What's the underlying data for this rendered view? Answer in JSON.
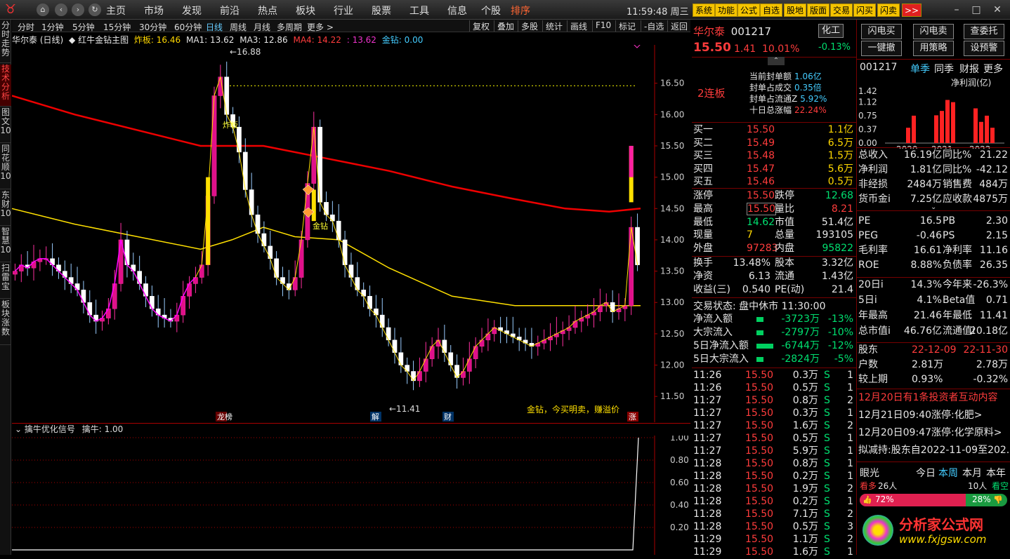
{
  "topbar": {
    "menus": [
      "主页",
      "市场",
      "发现",
      "前沿",
      "热点",
      "板块",
      "行业",
      "股票",
      "工具",
      "信息",
      "个股",
      "排序"
    ],
    "clock": "11:59:48 周三",
    "tools": [
      "系统",
      "功能",
      "公式",
      "自选",
      "股地",
      "版面",
      "交易",
      "闪买",
      "闪卖"
    ],
    "more": ">>"
  },
  "left_tabs": [
    "分时走势",
    "技术分析",
    "图文10",
    "同花顺10",
    "东财10",
    "智慧10",
    "扫雷宝",
    "板块涨数"
  ],
  "period_tabs": [
    "分时",
    "1分钟",
    "5分钟",
    "15分钟",
    "30分钟",
    "60分钟",
    "日线",
    "周线",
    "月线",
    "多周期",
    "更多 >"
  ],
  "chart_tools": [
    "复权",
    "叠加",
    "多股",
    "统计",
    "画线",
    "F10",
    "标记",
    "-自选",
    "返回"
  ],
  "chart_header": {
    "stock": "华尔泰 (日线)",
    "indicator": "红牛金钻主图",
    "zha": "炸板: 16.46",
    "ma1": "MA1: 13.62",
    "ma3": "MA3: 12.86",
    "ma4": "MA4: 14.22",
    "ma_extra": ": 13.62",
    "jz": "金钻: 0.00"
  },
  "chart_data": {
    "type": "candlestick",
    "x": [
      "d1",
      "d2",
      "d3",
      "d4",
      "d5",
      "d6",
      "d7",
      "d8",
      "d9",
      "d10",
      "d11",
      "d12",
      "d13",
      "d14",
      "d15",
      "d16",
      "d17",
      "d18",
      "d19",
      "d20",
      "d21",
      "d22",
      "d23",
      "d24",
      "d25",
      "d26",
      "d27",
      "d28",
      "d29",
      "d30",
      "d31",
      "d32",
      "d33",
      "d34",
      "d35",
      "d36",
      "d37",
      "d38",
      "d39",
      "d40",
      "d41",
      "d42",
      "d43",
      "d44",
      "d45",
      "d46",
      "d47",
      "d48",
      "d49",
      "d50",
      "d51",
      "d52",
      "d53",
      "d54",
      "d55",
      "d56",
      "d57",
      "d58",
      "d59",
      "d60",
      "d61",
      "d62",
      "d63",
      "d64",
      "d65",
      "d66",
      "d67",
      "d68",
      "d69",
      "d70",
      "d71",
      "d72",
      "d73",
      "d74",
      "d75",
      "d76",
      "d77",
      "d78",
      "d79",
      "d80",
      "d81",
      "d82",
      "d83",
      "d84",
      "d85",
      "d86",
      "d87",
      "d88",
      "d89",
      "d90",
      "d91",
      "d92",
      "d93",
      "d94",
      "d95",
      "d96",
      "d97",
      "d98",
      "d99",
      "d100",
      "d101",
      "d102",
      "d103",
      "d104",
      "d105",
      "d106",
      "d107",
      "d108",
      "d109",
      "d110",
      "d111",
      "d112",
      "d113",
      "d114",
      "d115",
      "d116",
      "d117",
      "d118",
      "d119",
      "d120",
      "d121",
      "d122",
      "d123",
      "d124",
      "d125",
      "d126",
      "d127",
      "d128",
      "d129",
      "d130",
      "d131",
      "d132",
      "d133",
      "d134",
      "d135",
      "d136",
      "d137",
      "d138",
      "d139",
      "d140",
      "d141",
      "d142",
      "d143",
      "d144",
      "d145",
      "d146",
      "d147",
      "d148",
      "d149",
      "d150",
      "d151",
      "d152",
      "d153",
      "d154",
      "d155",
      "d156",
      "d157",
      "d158",
      "d159",
      "d160",
      "d161",
      "d162",
      "d163",
      "d164",
      "d165",
      "d166",
      "d167",
      "d168",
      "d169",
      "d170",
      "d171",
      "d172",
      "d173",
      "d174",
      "d175",
      "d176",
      "d177",
      "d178",
      "d179",
      "d180",
      "d181",
      "d182",
      "d183",
      "d184",
      "d185",
      "d186",
      "d187",
      "d188",
      "d189",
      "d190",
      "d191",
      "d192",
      "d193",
      "d194",
      "d195",
      "d196",
      "d197",
      "d198",
      "d199",
      "d200",
      "d201",
      "d202",
      "d203",
      "d204",
      "d205",
      "d206",
      "d207",
      "d208",
      "d209",
      "d210",
      "d211",
      "d212",
      "d213",
      "d214",
      "d215",
      "d216",
      "d217",
      "d218",
      "d219",
      "d220",
      "d221",
      "d222",
      "d223",
      "d224",
      "d225",
      "d226",
      "d227",
      "d228",
      "d229",
      "d230",
      "d231",
      "d232",
      "d233",
      "d234",
      "d235",
      "d236",
      "d237",
      "d238",
      "d239",
      "d240",
      "d241",
      "d242",
      "d243",
      "d244",
      "d245",
      "d246",
      "d247",
      "d248",
      "d249",
      "d250",
      "d251",
      "d252",
      "d253",
      "d254",
      "d255",
      "d256",
      "d257",
      "d258",
      "d259",
      "d260",
      "d261",
      "d262",
      "d263",
      "d264",
      "d265",
      "d266",
      "d267",
      "d268",
      "d269",
      "d270",
      "d271",
      "d272",
      "d273",
      "d274",
      "d275",
      "d276",
      "d277",
      "d278",
      "d279",
      "d280",
      "d281",
      "d282",
      "d283",
      "d284",
      "d285",
      "d286",
      "d287",
      "d288",
      "d289",
      "d290",
      "d291",
      "d292",
      "d293",
      "d294",
      "d295",
      "d296",
      "d297",
      "d298",
      "d299",
      "d300"
    ],
    "ylim": [
      11.2,
      17.0
    ],
    "yticks": [
      16.5,
      16.0,
      15.5,
      15.0,
      14.5,
      14.0,
      13.5,
      13.0,
      12.5,
      12.0,
      11.5
    ],
    "ma_red": [
      [
        0,
        16.3
      ],
      [
        0.1,
        16.0
      ],
      [
        0.3,
        15.5
      ],
      [
        0.4,
        15.5
      ],
      [
        0.5,
        15.3
      ],
      [
        0.6,
        15.1
      ],
      [
        0.7,
        14.85
      ],
      [
        0.8,
        14.65
      ],
      [
        0.88,
        14.5
      ],
      [
        0.95,
        14.45
      ],
      [
        1.0,
        14.5
      ]
    ],
    "ma_yellow": [
      [
        0,
        14.5
      ],
      [
        0.1,
        14.25
      ],
      [
        0.2,
        14.05
      ],
      [
        0.3,
        13.85
      ],
      [
        0.35,
        14.0
      ],
      [
        0.4,
        14.2
      ],
      [
        0.45,
        14.05
      ],
      [
        0.52,
        14.0
      ],
      [
        0.6,
        13.55
      ],
      [
        0.7,
        13.1
      ],
      [
        0.8,
        12.95
      ],
      [
        0.88,
        12.95
      ],
      [
        0.95,
        12.95
      ],
      [
        1.0,
        12.95
      ]
    ],
    "closes": [
      13.5,
      13.6,
      13.55,
      13.65,
      13.7,
      13.7,
      13.6,
      13.5,
      13.4,
      13.3,
      13.2,
      13.0,
      12.8,
      12.7,
      12.75,
      12.9,
      13.3,
      14.0,
      13.6,
      13.5,
      13.3,
      13.1,
      12.9,
      12.8,
      12.75,
      12.7,
      12.8,
      13.1,
      13.3,
      13.4,
      13.6,
      14.7,
      16.3,
      16.6,
      16.0,
      15.8,
      15.4,
      14.8,
      14.4,
      14.1,
      13.9,
      13.7,
      13.4,
      13.3,
      13.2,
      13.4,
      14.0,
      14.9,
      15.8,
      14.6,
      14.4,
      14.3,
      14.0,
      13.6,
      13.4,
      13.2,
      13.1,
      12.9,
      12.8,
      12.6,
      12.4,
      12.2,
      12.0,
      11.9,
      11.75,
      11.9,
      12.1,
      12.3,
      12.4,
      12.2,
      12.0,
      11.8,
      11.9,
      12.1,
      12.3,
      12.4,
      12.5,
      12.6,
      12.55,
      12.5,
      12.45,
      12.4,
      12.35,
      12.3,
      12.35,
      12.4,
      12.45,
      12.5,
      12.55,
      12.6,
      12.7,
      12.75,
      12.8,
      12.85,
      12.95,
      13.0,
      12.85,
      12.9,
      12.95,
      14.2,
      13.6
    ],
    "annotations": [
      "16.88",
      "11.41",
      "炸板",
      "金钻",
      "金钻，今买明卖，赚溢价",
      "龙榜",
      "解",
      "财",
      "涨"
    ]
  },
  "indicator": {
    "name": "擒牛优化信号",
    "value": "擒牛: 1.00",
    "yticks": [
      "1.00",
      "0.80",
      "0.60",
      "0.40",
      "0.20"
    ]
  },
  "quote": {
    "name": "华尔泰",
    "code": "001217",
    "sector": "化工",
    "sector_change": "-0.13%",
    "price": "15.50",
    "change": "1.41",
    "pct": "10.01%",
    "board": "2连板",
    "seal": [
      {
        "label": "当前封单额",
        "value": "1.06亿"
      },
      {
        "label": "封单占成交",
        "value": "0.35倍"
      },
      {
        "label": "封单占流通Z",
        "value": "5.92%"
      },
      {
        "label": "十日总涨幅",
        "value": "22.24%"
      }
    ],
    "bids": [
      {
        "label": "买一",
        "price": "15.50",
        "vol": "1.1亿"
      },
      {
        "label": "买二",
        "price": "15.49",
        "vol": "6.5万"
      },
      {
        "label": "买三",
        "price": "15.48",
        "vol": "1.5万"
      },
      {
        "label": "买四",
        "price": "15.47",
        "vol": "5.6万"
      },
      {
        "label": "买五",
        "price": "15.46",
        "vol": "0.5万"
      }
    ],
    "stats": [
      {
        "l1": "涨停",
        "v1": "15.50",
        "l2": "跌停",
        "v2": "12.68"
      },
      {
        "l1": "最高",
        "v1": "15.50",
        "l2": "量比",
        "v2": "8.21"
      },
      {
        "l1": "最低",
        "v1": "14.62",
        "l2": "市值",
        "v2": "51.4亿"
      },
      {
        "l1": "现量",
        "v1": "7",
        "l2": "总量",
        "v2": "193105"
      },
      {
        "l1": "外盘",
        "v1": "97283",
        "l2": "内盘",
        "v2": "95822"
      }
    ],
    "stats2": [
      {
        "l1": "换手",
        "v1": "13.48%",
        "l2": "股本",
        "v2": "3.32亿"
      },
      {
        "l1": "净资",
        "v1": "6.13",
        "l2": "流通",
        "v2": "1.43亿"
      },
      {
        "l1": "收益(三)",
        "v1": "0.540",
        "l2": "PE(动)",
        "v2": "21.4"
      }
    ],
    "trade_state": "交易状态: 盘中休市 11:30:00",
    "flows": [
      {
        "label": "净流入额",
        "value": "-3723万",
        "pct": "-13%"
      },
      {
        "label": "大宗流入",
        "value": "-2797万",
        "pct": "-10%"
      },
      {
        "label": "5日净流入额",
        "value": "-6744万",
        "pct": "-12%"
      },
      {
        "label": "5日大宗流入",
        "value": "-2824万",
        "pct": "-5%"
      }
    ],
    "ticks": [
      {
        "t": "11:26",
        "p": "15.50",
        "v": "0.3万",
        "s": "S",
        "n": "1"
      },
      {
        "t": "11:26",
        "p": "15.50",
        "v": "0.5万",
        "s": "S",
        "n": "1"
      },
      {
        "t": "11:27",
        "p": "15.50",
        "v": "0.8万",
        "s": "S",
        "n": "2"
      },
      {
        "t": "11:27",
        "p": "15.50",
        "v": "0.3万",
        "s": "S",
        "n": "1"
      },
      {
        "t": "11:27",
        "p": "15.50",
        "v": "1.6万",
        "s": "S",
        "n": "2"
      },
      {
        "t": "11:27",
        "p": "15.50",
        "v": "0.5万",
        "s": "S",
        "n": "1"
      },
      {
        "t": "11:27",
        "p": "15.50",
        "v": "5.9万",
        "s": "S",
        "n": "1"
      },
      {
        "t": "11:28",
        "p": "15.50",
        "v": "0.8万",
        "s": "S",
        "n": "1"
      },
      {
        "t": "11:28",
        "p": "15.50",
        "v": "0.2万",
        "s": "S",
        "n": "1"
      },
      {
        "t": "11:28",
        "p": "15.50",
        "v": "1.9万",
        "s": "S",
        "n": "2"
      },
      {
        "t": "11:28",
        "p": "15.50",
        "v": "0.2万",
        "s": "S",
        "n": "1"
      },
      {
        "t": "11:28",
        "p": "15.50",
        "v": "7.1万",
        "s": "S",
        "n": "2"
      },
      {
        "t": "11:28",
        "p": "15.50",
        "v": "0.5万",
        "s": "S",
        "n": "3"
      },
      {
        "t": "11:29",
        "p": "15.50",
        "v": "1.1万",
        "s": "S",
        "n": "2"
      },
      {
        "t": "11:29",
        "p": "15.50",
        "v": "1.6万",
        "s": "S",
        "n": "1"
      }
    ]
  },
  "actions": {
    "flash_buy": "闪电买",
    "flash_sell": "闪电卖",
    "check": "查委托",
    "cancel": "一键撤",
    "strategy": "用策略",
    "alert": "设预警"
  },
  "fin": {
    "code": "001217",
    "tabs": [
      "单季",
      "同季",
      "财报",
      "更多"
    ],
    "chart_title": "净利润(亿)",
    "chart_data": {
      "type": "bar",
      "categories": [
        "2020",
        "2021",
        "2022"
      ],
      "yticks": [
        "1.42",
        "1.12",
        "0.75",
        "0.37",
        "0.00"
      ],
      "values": [
        0.42,
        0.75,
        0.76,
        0.88,
        1.18,
        1.12,
        0.95,
        0.58,
        0.75,
        0.42
      ]
    },
    "rows": [
      {
        "l1": "总收入",
        "v1": "16.19亿",
        "l2": "同比%",
        "v2": "21.22"
      },
      {
        "l1": "净利润",
        "v1": "1.81亿",
        "l2": "同比%",
        "v2": "-42.12"
      },
      {
        "l1": "非经损",
        "v1": "2484万",
        "l2": "销售费",
        "v2": "484万"
      },
      {
        "l1": "货币金i",
        "v1": "7.25亿",
        "l2": "应收款",
        "v2": "4875万"
      }
    ],
    "rows2": [
      {
        "l1": "PE",
        "v1": "16.5",
        "l2": "PB",
        "v2": "2.30"
      },
      {
        "l1": "PEG",
        "v1": "-0.46",
        "l2": "PS",
        "v2": "2.15"
      },
      {
        "l1": "毛利率",
        "v1": "16.61",
        "l2": "净利率",
        "v2": "11.16"
      },
      {
        "l1": "ROE",
        "v1": "8.88%",
        "l2": "负债率",
        "v2": "26.35"
      }
    ],
    "rows3": [
      {
        "l1": "20日i",
        "v1": "14.3%",
        "l2": "今年来",
        "v2": "-26.3%"
      },
      {
        "l1": "5日i",
        "v1": "4.1%",
        "l2": "Beta值",
        "v2": "0.71"
      },
      {
        "l1": "年最高",
        "v1": "21.46",
        "l2": "年最低",
        "v2": "11.41"
      },
      {
        "l1": "总市值i",
        "v1": "46.76亿",
        "l2": "流通值i",
        "v2": "20.18亿"
      }
    ],
    "holders": [
      {
        "l": "股东",
        "v1": "22-12-09",
        "v2": "22-11-30"
      },
      {
        "l": "户数",
        "v1": "2.81万",
        "v2": "2.78万"
      },
      {
        "l": "较上期",
        "v1": "0.93%",
        "v2": "-0.32%"
      }
    ],
    "news": [
      "12月20日有1条投资者互动内容",
      "12月21日09:40涨停:化肥>",
      "12月20日09:47涨停:化学原料>",
      "拟减持:股东自2022-11-09至202..."
    ],
    "vision": {
      "title": "眼光",
      "tabs": [
        "今日",
        "本周",
        "本月",
        "本年"
      ],
      "bull_label": "看多",
      "bull_count": "26人",
      "bear_count": "10人",
      "bear_label": "看空",
      "bull_pct": "72%",
      "bear_pct": "28%",
      "bull_fraction": 0.72
    },
    "watermark": "分析家公式网",
    "watermark_url": "www.fxjgsw.com"
  }
}
